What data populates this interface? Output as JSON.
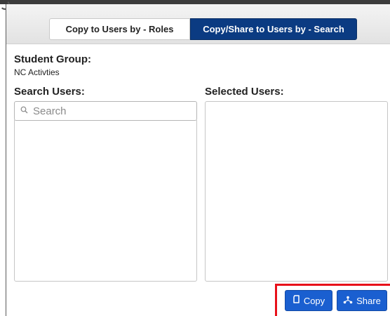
{
  "tabs": {
    "roles_label": "Copy to Users by - Roles",
    "search_label": "Copy/Share to Users by - Search",
    "active_color": "#0b3b82"
  },
  "student_group": {
    "heading": "Student Group:",
    "value": "NC Activties"
  },
  "search_users": {
    "heading": "Search Users:",
    "placeholder": "Search",
    "icon": "search-icon"
  },
  "selected_users": {
    "heading": "Selected Users:"
  },
  "actions": {
    "copy_label": "Copy",
    "copy_icon": "copy-icon",
    "share_label": "Share",
    "share_icon": "share-icon",
    "button_color": "#1a5fd0",
    "highlight_color": "#e8101a"
  }
}
